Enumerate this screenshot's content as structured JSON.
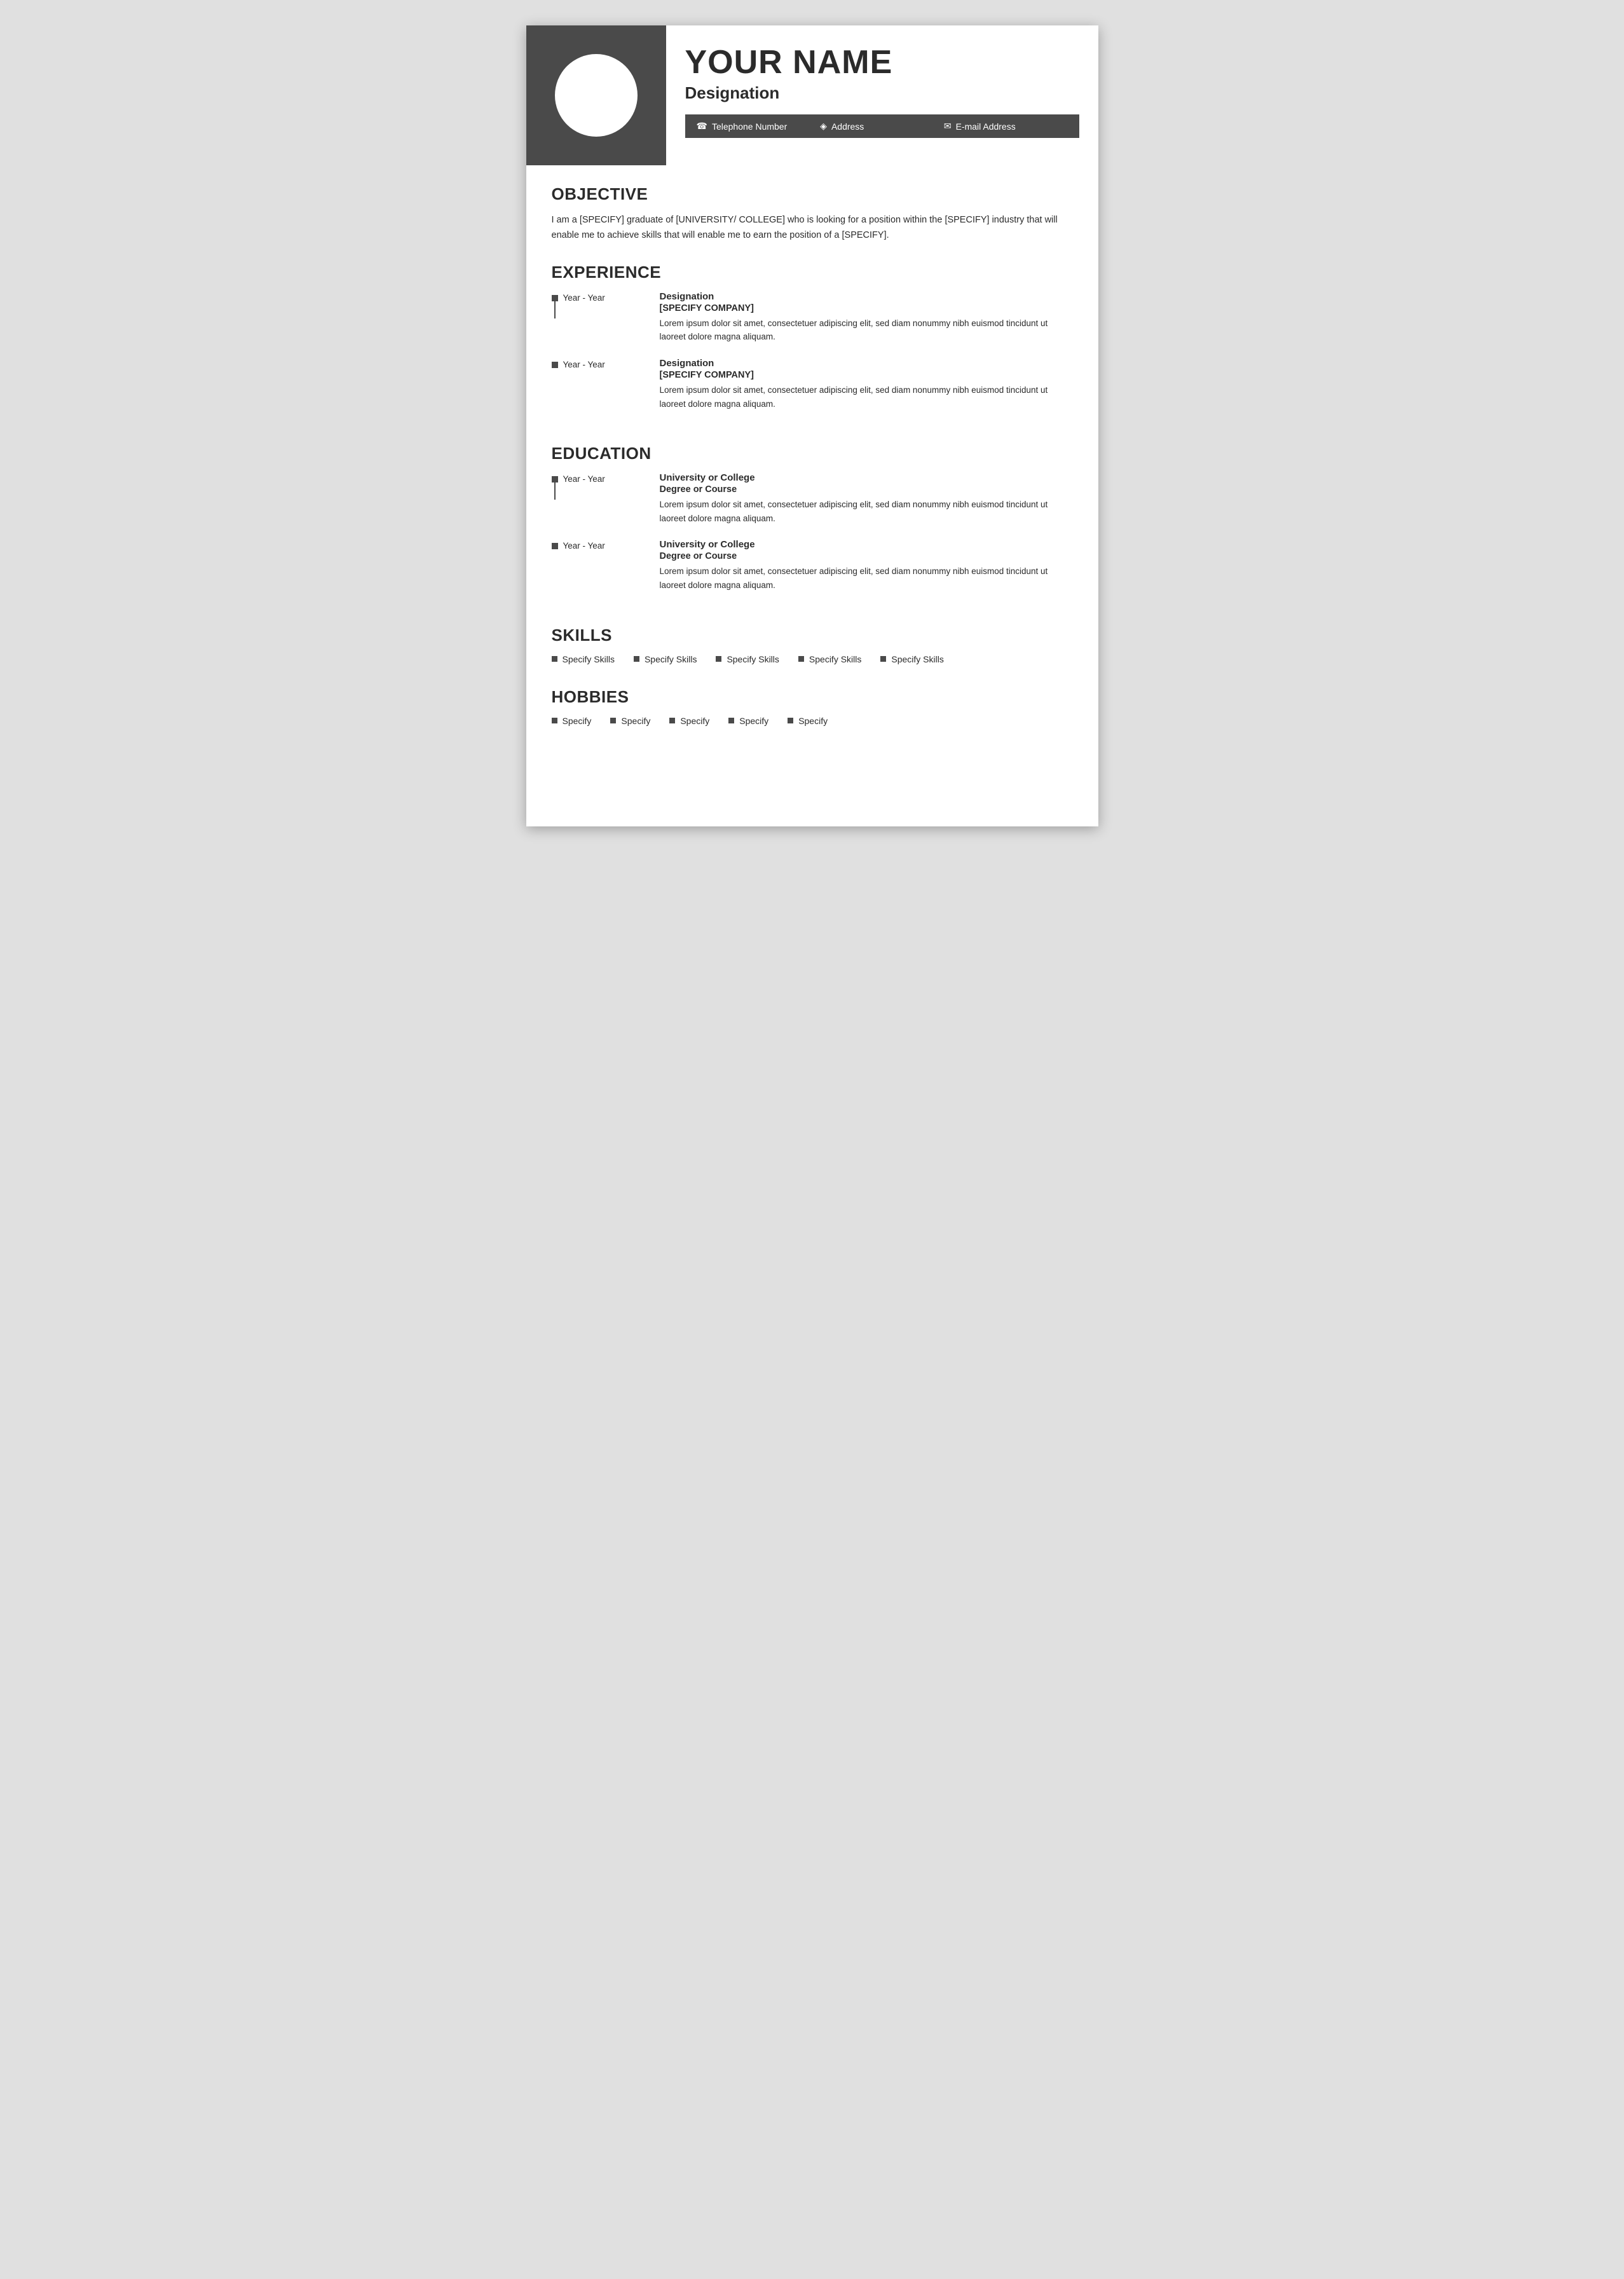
{
  "header": {
    "name": "YOUR NAME",
    "designation": "Designation",
    "contact": {
      "phone_icon": "☎",
      "phone": "Telephone Number",
      "address_icon": "◈",
      "address": "Address",
      "email_icon": "✉",
      "email": "E-mail Address"
    }
  },
  "objective": {
    "section_title": "OBJECTIVE",
    "text": "I am a [SPECIFY] graduate of [UNIVERSITY/ COLLEGE] who is looking for a position within the [SPECIFY] industry that will enable me to achieve skills that will enable me to earn the position of a [SPECIFY]."
  },
  "experience": {
    "section_title": "EXPERIENCE",
    "items": [
      {
        "years": "Year - Year",
        "designation": "Designation",
        "company": "[SPECIFY COMPANY]",
        "description": "Lorem ipsum dolor sit amet, consectetuer adipiscing elit, sed diam nonummy nibh euismod tincidunt ut laoreet dolore magna aliquam."
      },
      {
        "years": "Year - Year",
        "designation": "Designation",
        "company": "[SPECIFY COMPANY]",
        "description": "Lorem ipsum dolor sit amet, consectetuer adipiscing elit, sed diam nonummy nibh euismod tincidunt ut laoreet dolore magna aliquam."
      }
    ]
  },
  "education": {
    "section_title": "EDUCATION",
    "items": [
      {
        "years": "Year - Year",
        "institution": "University or College",
        "degree": "Degree or Course",
        "description": "Lorem ipsum dolor sit amet, consectetuer adipiscing elit, sed diam nonummy nibh euismod tincidunt ut laoreet dolore magna aliquam."
      },
      {
        "years": "Year - Year",
        "institution": "University or College",
        "degree": "Degree or Course",
        "description": "Lorem ipsum dolor sit amet, consectetuer adipiscing elit, sed diam nonummy nibh euismod tincidunt ut laoreet dolore magna aliquam."
      }
    ]
  },
  "skills": {
    "section_title": "SKILLS",
    "items": [
      "Specify Skills",
      "Specify Skills",
      "Specify Skills",
      "Specify Skills",
      "Specify Skills"
    ]
  },
  "hobbies": {
    "section_title": "HOBBIES",
    "items": [
      "Specify",
      "Specify",
      "Specify",
      "Specify",
      "Specify"
    ]
  }
}
